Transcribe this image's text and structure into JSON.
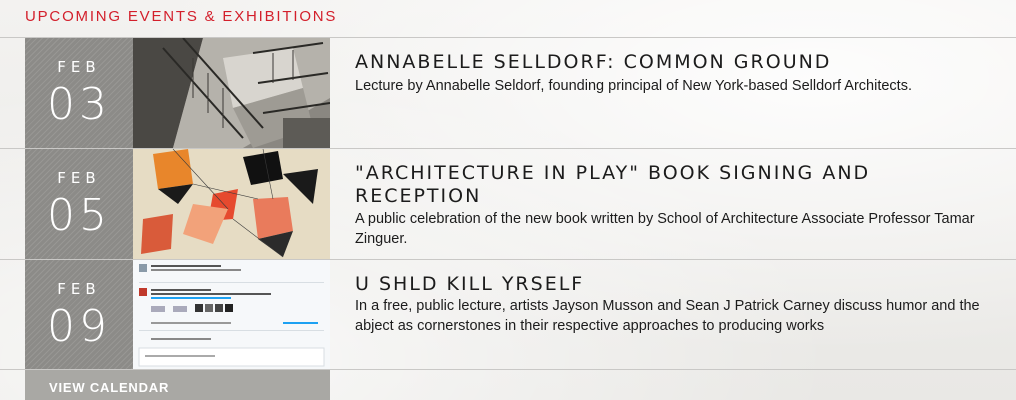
{
  "header": {
    "title": "UPCOMING EVENTS & EXHIBITIONS"
  },
  "colors": {
    "accent": "#d31f2b",
    "date_block": "#8c8b88",
    "calendar_bg": "#a9a8a4"
  },
  "events": [
    {
      "month": "FEB",
      "day": "03",
      "title": "ANNABELLE SELLDORF: COMMON GROUND",
      "description": "Lecture by Annabelle Seldorf, founding principal of New York-based Selldorf Architects.",
      "image": "staircase-photo"
    },
    {
      "month": "FEB",
      "day": "05",
      "title": "\"ARCHITECTURE IN PLAY\" BOOK SIGNING AND RECEPTION",
      "description": "A public celebration of the new book written by School of Architecture Associate Professor Tamar Zinguer.",
      "image": "colorful-shapes-photo"
    },
    {
      "month": "FEB",
      "day": "09",
      "title": "U SHLD KILL YRSELF",
      "description": "In a free, public lecture, artists Jayson Musson and Sean J Patrick Carney discuss humor and the abject as cornerstones in their respective approaches to producing works",
      "image": "tweet-screenshot"
    }
  ],
  "footer": {
    "calendar_label": "VIEW CALENDAR"
  }
}
